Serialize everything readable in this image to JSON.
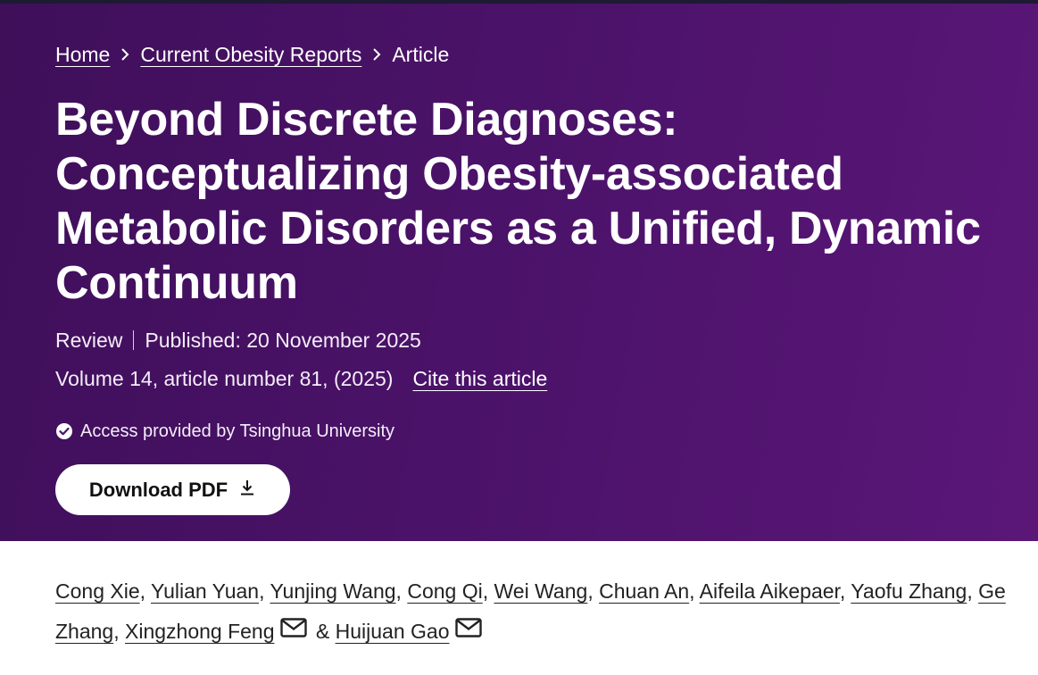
{
  "breadcrumb": {
    "home": "Home",
    "journal": "Current Obesity Reports",
    "current": "Article"
  },
  "article": {
    "title": "Beyond Discrete Diagnoses: Conceptualizing Obesity-associated Metabolic Disorders as a Unified, Dynamic Continuum",
    "type": "Review",
    "published": "Published: 20 November 2025",
    "volume": "Volume 14, article number 81, (2025)",
    "cite_label": "Cite this article",
    "access": "Access provided by Tsinghua University",
    "download_label": "Download PDF"
  },
  "authors": [
    {
      "name": "Cong Xie",
      "sep": ", "
    },
    {
      "name": "Yulian Yuan",
      "sep": ", "
    },
    {
      "name": "Yunjing Wang",
      "sep": ", "
    },
    {
      "name": "Cong Qi",
      "sep": ", "
    },
    {
      "name": "Wei Wang",
      "sep": ", "
    },
    {
      "name": "Chuan An",
      "sep": ", "
    },
    {
      "name": "Aifeila Aikepaer",
      "sep": ", "
    },
    {
      "name": "Yaofu Zhang",
      "sep": ", "
    },
    {
      "name": "Ge Zhang",
      "sep": ", "
    },
    {
      "name": "Xingzhong Feng",
      "sep": " & ",
      "mail": true
    },
    {
      "name": "Huijuan Gao",
      "sep": "",
      "mail": true
    }
  ],
  "icons": {
    "breadcrumb_separator": "chevron-right-icon",
    "access": "check-circle-icon",
    "download": "download-icon",
    "email": "envelope-icon"
  },
  "colors": {
    "hero_start": "#3f0f5a",
    "hero_end": "#5a1778",
    "text_on_hero": "#ffffff",
    "button_bg": "#ffffff"
  }
}
